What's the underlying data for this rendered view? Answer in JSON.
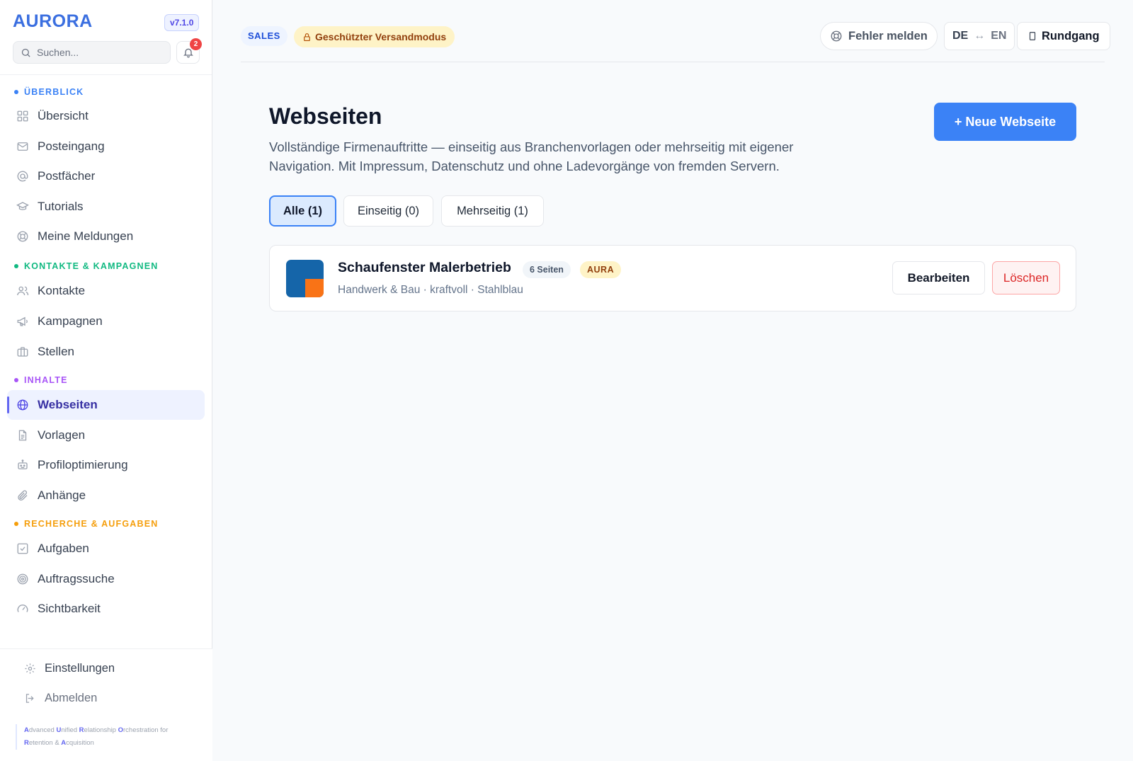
{
  "app": {
    "logo": "AURORA",
    "version": "v7.1.0"
  },
  "search": {
    "placeholder": "Suchen..."
  },
  "notifications": {
    "count": "2"
  },
  "sidebar": {
    "sections": [
      {
        "label": "ÜBERBLICK",
        "color": "#3b82f6",
        "items": [
          {
            "label": "Übersicht",
            "icon": "grid-icon"
          },
          {
            "label": "Posteingang",
            "icon": "mail-icon"
          },
          {
            "label": "Postfächer",
            "icon": "at-icon"
          },
          {
            "label": "Tutorials",
            "icon": "graduation-cap-icon"
          },
          {
            "label": "Meine Meldungen",
            "icon": "lifebuoy-icon"
          }
        ]
      },
      {
        "label": "KONTAKTE & KAMPAGNEN",
        "color": "#10b981",
        "items": [
          {
            "label": "Kontakte",
            "icon": "users-icon"
          },
          {
            "label": "Kampagnen",
            "icon": "megaphone-icon"
          },
          {
            "label": "Stellen",
            "icon": "briefcase-icon"
          }
        ]
      },
      {
        "label": "INHALTE",
        "color": "#a855f7",
        "items": [
          {
            "label": "Webseiten",
            "icon": "globe-icon",
            "active": true
          },
          {
            "label": "Vorlagen",
            "icon": "document-icon"
          },
          {
            "label": "Profiloptimierung",
            "icon": "robot-icon"
          },
          {
            "label": "Anhänge",
            "icon": "paperclip-icon"
          }
        ]
      },
      {
        "label": "RECHERCHE & AUFGABEN",
        "color": "#f59e0b",
        "items": [
          {
            "label": "Aufgaben",
            "icon": "checkbox-icon"
          },
          {
            "label": "Auftragssuche",
            "icon": "target-icon"
          },
          {
            "label": "Sichtbarkeit",
            "icon": "gauge-icon"
          }
        ]
      }
    ],
    "bottom": {
      "settings": "Einstellungen",
      "logout": "Abmelden"
    },
    "tagline": [
      {
        "b": "A",
        "t": "dvanced "
      },
      {
        "b": "U",
        "t": "nified "
      },
      {
        "b": "R",
        "t": "elationship "
      },
      {
        "b": "O",
        "t": "rchestration for "
      },
      {
        "b": "R",
        "t": "etention & "
      },
      {
        "b": "A",
        "t": "cquisition"
      }
    ]
  },
  "topbar": {
    "sales_pill": "SALES",
    "mode_pill": "Geschützter Versandmodus",
    "report_button": "Fehler melden",
    "lang_de": "DE",
    "lang_arrow": "↔",
    "lang_en": "EN",
    "tour_button": "Rundgang"
  },
  "main": {
    "title": "Webseiten",
    "description": "Vollständige Firmenauftritte — einseitig aus Branchenvorlagen oder mehrseitig mit eigener Navigation. Mit Impressum, Datenschutz und ohne Ladevorgänge von fremden Servern.",
    "new_button": "+ Neue Webseite",
    "filters": [
      {
        "label": "Alle (1)",
        "active": true
      },
      {
        "label": "Einseitig (0)",
        "active": false
      },
      {
        "label": "Mehrseitig (1)",
        "active": false
      }
    ],
    "websites": [
      {
        "name": "Schaufenster Malerbetrieb",
        "pages_badge": "6 Seiten",
        "aura_badge": "AURA",
        "meta": "Handwerk & Bau · kraftvoll · Stahlblau",
        "edit_label": "Bearbeiten",
        "delete_label": "Löschen",
        "thumb_colors": {
          "primary": "#1565a9",
          "accent": "#f97316"
        }
      }
    ]
  }
}
